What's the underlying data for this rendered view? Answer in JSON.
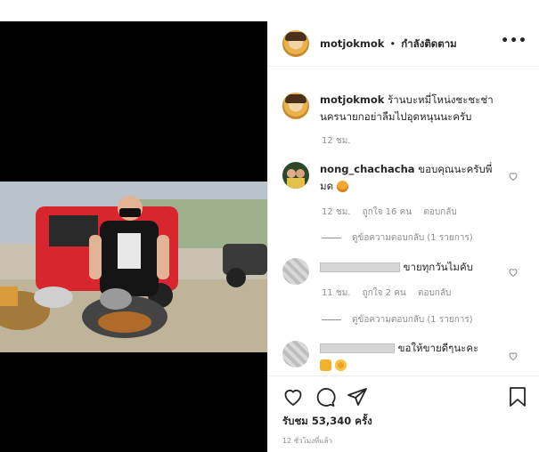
{
  "post": {
    "username": "motjokmok",
    "dot": "•",
    "follow_status": "กำลังติดตาม",
    "more_icon": "•••"
  },
  "caption": {
    "username": "motjokmok",
    "text_line1": "ร้านบะหมี่โหน่งชะชะช่า",
    "text_line2": "นครนายกอย่าลืมไปอุดหนุนนะครับ",
    "time": "12 ชม."
  },
  "comments": [
    {
      "username": "nong_chachacha",
      "text_line1": "ขอบคุณนะครับพี่",
      "text_line2": "มด",
      "time": "12 ชม.",
      "likes": "ถูกใจ 16 คน",
      "reply_label": "ตอบกลับ",
      "view_replies": "ดูข้อความตอบกลับ (1 รายการ)"
    },
    {
      "text": "ขายทุกวันไมคับ",
      "time": "11 ชม.",
      "likes": "ถูกใจ 2 คน",
      "reply_label": "ตอบกลับ",
      "view_replies": "ดูข้อความตอบกลับ (1 รายการ)"
    },
    {
      "text": "ขอให้ขายดีๆนะคะ"
    }
  ],
  "stats": {
    "views": "รับชม 53,340 ครั้ง",
    "posted_ago": "12 ชั่วโมงที่แล้ว"
  },
  "colors": {
    "text": "#262626",
    "muted": "#8e8e8e",
    "border": "#efefef"
  }
}
